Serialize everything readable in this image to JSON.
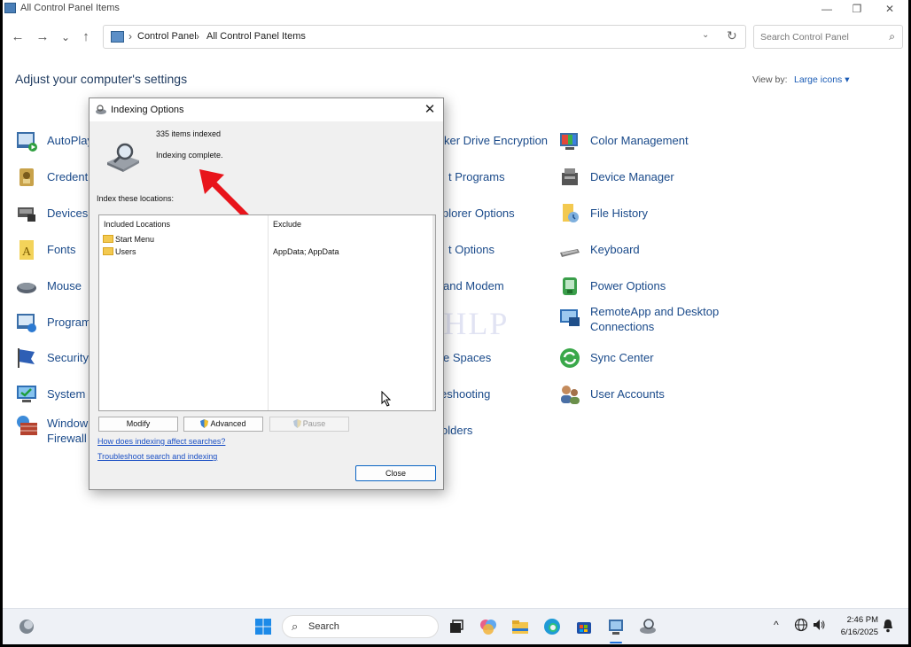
{
  "window": {
    "title": "All Control Panel Items",
    "controls": {
      "minimize": "—",
      "maximize": "❐",
      "close": "✕"
    }
  },
  "nav": {
    "back": "←",
    "forward": "→",
    "recent": "⌄",
    "up": "↑",
    "breadcrumb": [
      "Control Panel",
      "All Control Panel Items"
    ],
    "breadcrumb_sep": "›",
    "dropdown": "⌄",
    "refresh": "↻",
    "search_placeholder": "Search Control Panel",
    "search_icon": "⌕"
  },
  "content": {
    "heading": "Adjust your computer's settings",
    "view_by_label": "View by:",
    "view_by_value": "Large icons ▾"
  },
  "items_col1": [
    {
      "label": "AutoPlay",
      "icon": "autoplay-icon"
    },
    {
      "label": "Credentia",
      "icon": "credential-manager-icon"
    },
    {
      "label": "Devices",
      "icon": "devices-icon"
    },
    {
      "label": "Fonts",
      "icon": "fonts-icon"
    },
    {
      "label": "Mouse",
      "icon": "mouse-icon"
    },
    {
      "label": "Program",
      "icon": "programs-icon"
    },
    {
      "label": "Security",
      "icon": "security-icon"
    },
    {
      "label": "System",
      "icon": "system-icon"
    },
    {
      "label": "Window\nFirewall",
      "icon": "firewall-icon"
    }
  ],
  "items_col2": [
    {
      "label": "ker Drive Encryption"
    },
    {
      "label": "t Programs"
    },
    {
      "label": "plorer Options"
    },
    {
      "label": "t Options"
    },
    {
      "label": "and Modem"
    },
    {
      "label": ""
    },
    {
      "label": "e Spaces"
    },
    {
      "label": "eshooting"
    },
    {
      "label": "olders"
    }
  ],
  "items_col3": [
    {
      "label": "Color Management",
      "icon": "color-management-icon"
    },
    {
      "label": "Device Manager",
      "icon": "device-manager-icon"
    },
    {
      "label": "File History",
      "icon": "file-history-icon"
    },
    {
      "label": "Keyboard",
      "icon": "keyboard-icon"
    },
    {
      "label": "Power Options",
      "icon": "power-options-icon"
    },
    {
      "label": "RemoteApp and Desktop\nConnections",
      "icon": "remoteapp-icon"
    },
    {
      "label": "Sync Center",
      "icon": "sync-center-icon"
    },
    {
      "label": "User Accounts",
      "icon": "user-accounts-icon"
    }
  ],
  "dialog": {
    "title": "Indexing Options",
    "close": "✕",
    "items_indexed": "335 items indexed",
    "status": "Indexing complete.",
    "section_label": "Index these locations:",
    "columns": {
      "included": "Included Locations",
      "exclude": "Exclude"
    },
    "locations": [
      {
        "name": "Start Menu",
        "exclude": ""
      },
      {
        "name": "Users",
        "exclude": "AppData; AppData"
      }
    ],
    "buttons": {
      "modify": "Modify",
      "advanced": "Advanced",
      "pause": "Pause"
    },
    "link_affect": "How does indexing affect searches?",
    "link_troubleshoot": "Troubleshoot search and indexing",
    "close_button": "Close"
  },
  "watermark": "IT Pros HLP",
  "taskbar": {
    "search_text": "Search",
    "tray_chevron": "^",
    "time": "2:46 PM",
    "date": "6/16/2025"
  },
  "colors": {
    "accent": "#1a5bb5",
    "link": "#1a4a8a",
    "arrow": "#e8141b",
    "dialog_bg": "#f0f0f0"
  }
}
